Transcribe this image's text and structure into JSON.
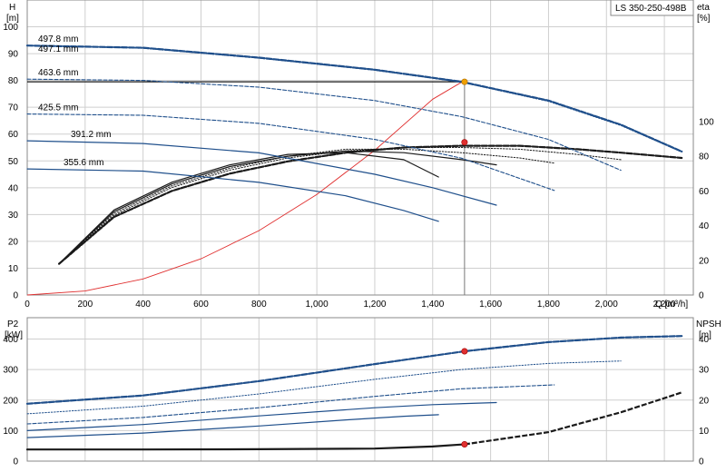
{
  "model_label": "LS 350-250-498B",
  "colors": {
    "blue": "#1f4f8b",
    "black": "#1a1a1a",
    "red": "#e03030",
    "orange": "#f0a000",
    "duty_line": "#777777",
    "grid": "#cfcfcf"
  },
  "chart_data": [
    {
      "type": "line",
      "panel": "head_efficiency",
      "left_axis": {
        "label_line1": "H",
        "label_line2": "[m]",
        "ylim": [
          0,
          110
        ],
        "ticks": [
          0,
          10,
          20,
          30,
          40,
          50,
          60,
          70,
          80,
          90,
          100
        ]
      },
      "right_axis": {
        "label_line1": "eta",
        "label_line2": "[%]",
        "ylim": [
          0,
          170
        ],
        "ticks": [
          0,
          20,
          40,
          60,
          80,
          100
        ]
      },
      "x_axis": {
        "label": "Q [m³/h]",
        "xlim": [
          0,
          2300
        ],
        "ticks": [
          0,
          200,
          400,
          600,
          800,
          1000,
          1200,
          1400,
          1600,
          1800,
          2000,
          2200
        ],
        "tick_labels": [
          "0",
          "200",
          "400",
          "600",
          "800",
          "1,000",
          "1,200",
          "1,400",
          "1,600",
          "1,800",
          "2,000",
          "2,200"
        ]
      },
      "grid": true,
      "head_curves": [
        {
          "name": "497.8 mm",
          "x": [
            0,
            400,
            800,
            1200,
            1500,
            1800,
            2050,
            2260
          ],
          "y": [
            93,
            92.2,
            88.5,
            84,
            79.5,
            72.5,
            63.5,
            53.5
          ],
          "style": "dashed-bold"
        },
        {
          "name": "497.1 mm",
          "x": [
            0,
            400,
            800,
            1200,
            1500,
            1800,
            2050,
            2260
          ],
          "y": [
            93,
            92,
            88.3,
            83.8,
            79.3,
            72.2,
            63.2,
            53.3
          ],
          "style": "dotted"
        },
        {
          "name": "463.6 mm",
          "x": [
            0,
            400,
            800,
            1200,
            1500,
            1800,
            2050
          ],
          "y": [
            80.5,
            80,
            77.5,
            72.5,
            66.5,
            58,
            46.5
          ],
          "style": "dashed"
        },
        {
          "name": "425.5 mm",
          "x": [
            0,
            400,
            800,
            1200,
            1500,
            1820
          ],
          "y": [
            67.5,
            67,
            64,
            58,
            51,
            39
          ],
          "style": "dashed"
        },
        {
          "name": "391.2 mm",
          "x": [
            0,
            400,
            800,
            1200,
            1400,
            1620
          ],
          "y": [
            57.5,
            56.5,
            53,
            45,
            40,
            33.5
          ],
          "style": "solid"
        },
        {
          "name": "355.6 mm",
          "x": [
            0,
            400,
            800,
            1100,
            1300,
            1420
          ],
          "y": [
            47,
            46.2,
            42,
            37,
            31.5,
            27.5
          ],
          "style": "solid"
        }
      ],
      "efficiency_curves": [
        {
          "x": [
            110,
            300,
            500,
            700,
            900,
            1100,
            1300,
            1500,
            1700,
            1900,
            2050,
            2260
          ],
          "y": [
            18,
            45,
            60,
            70,
            77,
            82,
            85,
            86,
            86,
            84,
            82,
            79
          ],
          "style": "dashed-bold"
        },
        {
          "x": [
            110,
            300,
            500,
            700,
            900,
            1100,
            1300,
            1500,
            1700,
            1900,
            2050
          ],
          "y": [
            18,
            46,
            62,
            72,
            79,
            83,
            85,
            85,
            84,
            81,
            78
          ],
          "style": "dotted"
        },
        {
          "x": [
            110,
            300,
            500,
            700,
            900,
            1100,
            1300,
            1500,
            1700,
            1820
          ],
          "y": [
            18,
            47,
            63,
            73,
            80,
            84,
            84,
            82,
            79,
            76
          ],
          "style": "dotted"
        },
        {
          "x": [
            110,
            300,
            500,
            700,
            900,
            1100,
            1300,
            1500,
            1620
          ],
          "y": [
            18,
            48,
            64,
            74,
            80,
            83,
            82,
            78,
            75
          ],
          "style": "solid"
        },
        {
          "x": [
            110,
            300,
            500,
            700,
            900,
            1100,
            1300,
            1420
          ],
          "y": [
            18,
            49,
            65,
            75,
            81,
            82,
            78,
            68
          ],
          "style": "solid"
        }
      ],
      "system_curve": {
        "x": [
          0,
          200,
          400,
          600,
          800,
          1000,
          1200,
          1400,
          1510
        ],
        "y": [
          0,
          1.5,
          6,
          13.5,
          24,
          37.5,
          54,
          73,
          80
        ]
      },
      "duty_point": {
        "q": 1510,
        "h": 79.5,
        "eta": 88,
        "label_color": "orange"
      }
    },
    {
      "type": "line",
      "panel": "power_npsh",
      "left_axis": {
        "label_line1": "P2",
        "label_line2": "[kW]",
        "ylim": [
          0,
          470
        ],
        "ticks": [
          0,
          100,
          200,
          300,
          400
        ]
      },
      "right_axis": {
        "label_line1": "NPSH",
        "label_line2": "[m]",
        "ylim": [
          0,
          47
        ],
        "ticks": [
          0,
          10,
          20,
          30,
          40
        ]
      },
      "x_axis": {
        "xlim": [
          0,
          2300
        ],
        "ticks": [
          0,
          200,
          400,
          600,
          800,
          1000,
          1200,
          1400,
          1600,
          1800,
          2000,
          2200
        ]
      },
      "grid": true,
      "power_curves": [
        {
          "x": [
            0,
            400,
            800,
            1200,
            1510,
            1800,
            2050,
            2260
          ],
          "y": [
            188,
            215,
            262,
            318,
            360,
            390,
            405,
            410
          ],
          "style": "dashed-bold"
        },
        {
          "x": [
            0,
            400,
            800,
            1200,
            1500,
            1800,
            2050
          ],
          "y": [
            155,
            180,
            220,
            268,
            300,
            320,
            328
          ],
          "style": "dotted"
        },
        {
          "x": [
            0,
            400,
            800,
            1200,
            1500,
            1820
          ],
          "y": [
            122,
            143,
            175,
            212,
            237,
            250
          ],
          "style": "dashed"
        },
        {
          "x": [
            0,
            400,
            800,
            1200,
            1400,
            1620
          ],
          "y": [
            100,
            120,
            148,
            175,
            185,
            192
          ],
          "style": "solid"
        },
        {
          "x": [
            0,
            400,
            800,
            1100,
            1300,
            1420
          ],
          "y": [
            77,
            92,
            115,
            135,
            147,
            152
          ],
          "style": "solid"
        }
      ],
      "npsh_curve": {
        "x": [
          0,
          400,
          800,
          1200,
          1400,
          1510,
          1800,
          2050,
          2260
        ],
        "y": [
          3.8,
          3.8,
          3.9,
          4.1,
          4.8,
          5.5,
          9.5,
          16,
          22.5
        ]
      },
      "duty_point": {
        "q": 1510,
        "p2": 360,
        "npsh": 5.5
      }
    }
  ]
}
